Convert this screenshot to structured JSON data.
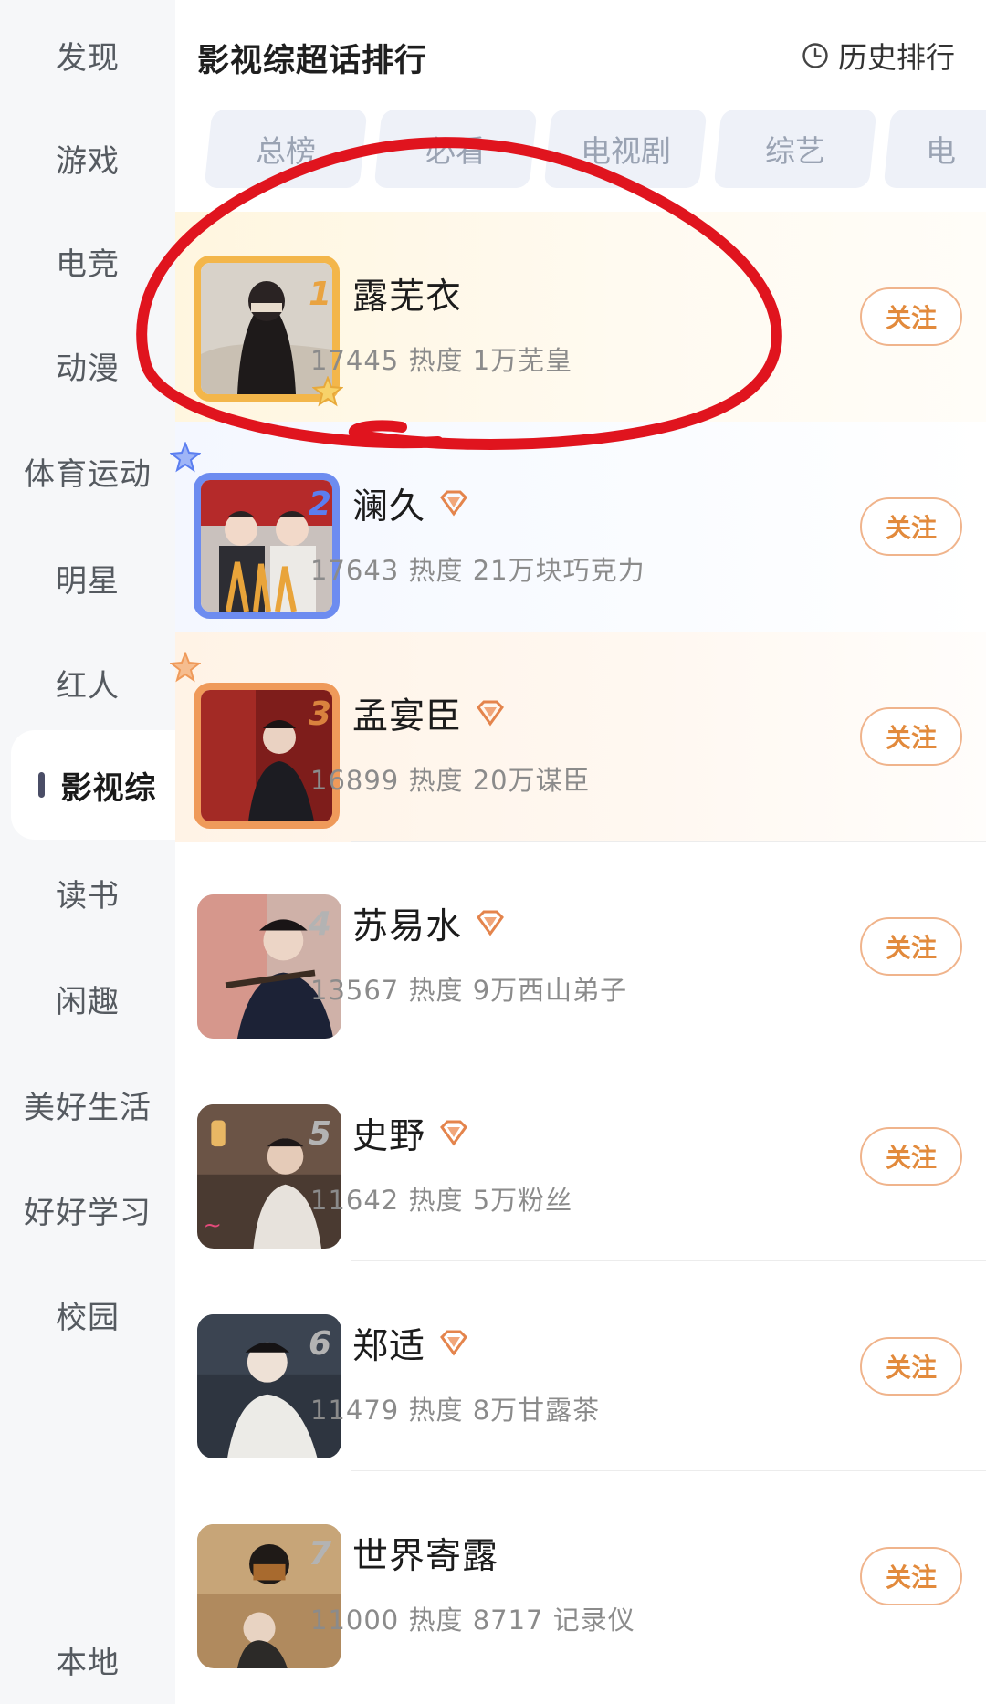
{
  "sidebar": {
    "items": [
      {
        "label": "发现"
      },
      {
        "label": "游戏"
      },
      {
        "label": "电竞"
      },
      {
        "label": "动漫"
      },
      {
        "label": "体育运动"
      },
      {
        "label": "明星"
      },
      {
        "label": "红人"
      },
      {
        "label": "影视综",
        "active": true
      },
      {
        "label": "读书"
      },
      {
        "label": "闲趣"
      },
      {
        "label": "美好生活"
      },
      {
        "label": "好好学习"
      },
      {
        "label": "校园"
      },
      {
        "label": "本地"
      }
    ]
  },
  "header": {
    "title": "影视综超话排行",
    "history_label": "历史排行"
  },
  "tabs": [
    {
      "label": "总榜"
    },
    {
      "label": "必看"
    },
    {
      "label": "电视剧"
    },
    {
      "label": "综艺"
    },
    {
      "label": "电"
    }
  ],
  "rankings": [
    {
      "rank": "1",
      "name": "露芜衣",
      "stats": "17445 热度  1万芜皇",
      "follow": "关注",
      "badge": false
    },
    {
      "rank": "2",
      "name": "澜久",
      "stats": "17643 热度  21万块巧克力",
      "follow": "关注",
      "badge": true
    },
    {
      "rank": "3",
      "name": "孟宴臣",
      "stats": "16899 热度  20万谋臣",
      "follow": "关注",
      "badge": true
    },
    {
      "rank": "4",
      "name": "苏易水",
      "stats": "13567 热度  9万西山弟子",
      "follow": "关注",
      "badge": true
    },
    {
      "rank": "5",
      "name": "史野",
      "stats": "11642 热度  5万粉丝",
      "follow": "关注",
      "badge": true
    },
    {
      "rank": "6",
      "name": "郑适",
      "stats": "11479 热度  8万甘露茶",
      "follow": "关注",
      "badge": true
    },
    {
      "rank": "7",
      "name": "世界寄露",
      "stats": "11000 热度  8717 记录仪",
      "follow": "关注",
      "badge": false
    }
  ],
  "colors": {
    "accent_follow": "#e28a3c",
    "annotation_red": "#e0141e",
    "gold": "#f3b64a",
    "blue": "#6d8cf0"
  }
}
